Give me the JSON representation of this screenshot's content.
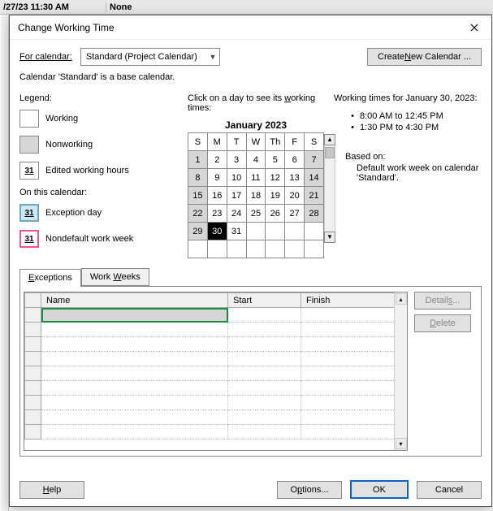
{
  "background": {
    "date": "/27/23 11:30 AM",
    "col2": "None"
  },
  "dialog": {
    "title": "Change Working Time",
    "forCalendarLabel": "For calendar:",
    "forCalendarValue": "Standard (Project Calendar)",
    "createNewBtn_pre": "Create ",
    "createNewBtn_ukey": "N",
    "createNewBtn_post": "ew Calendar ...",
    "baselineText": "Calendar 'Standard' is a base calendar.",
    "legend": {
      "header_pre": "Le",
      "header_ukey": "g",
      "header_post": "end:",
      "working": "Working",
      "nonworking": "Nonworking",
      "editedSwatch": "31",
      "edited": "Edited working hours",
      "onThisCal": "On this calendar:",
      "exSwatch": "31",
      "exception": "Exception day",
      "ndSwatch": "31",
      "nondefault": "Nondefault work week"
    },
    "calendar": {
      "prompt_pre": "Click on a day to see its ",
      "prompt_ukey": "w",
      "prompt_post": "orking times:",
      "monthLabel": "January 2023",
      "dow": [
        "S",
        "M",
        "T",
        "W",
        "Th",
        "F",
        "S"
      ],
      "weeks": [
        [
          {
            "n": "1",
            "w": true
          },
          {
            "n": "2"
          },
          {
            "n": "3"
          },
          {
            "n": "4"
          },
          {
            "n": "5"
          },
          {
            "n": "6"
          },
          {
            "n": "7",
            "w": true
          }
        ],
        [
          {
            "n": "8",
            "w": true
          },
          {
            "n": "9"
          },
          {
            "n": "10"
          },
          {
            "n": "11"
          },
          {
            "n": "12"
          },
          {
            "n": "13"
          },
          {
            "n": "14",
            "w": true
          }
        ],
        [
          {
            "n": "15",
            "w": true
          },
          {
            "n": "16"
          },
          {
            "n": "17"
          },
          {
            "n": "18"
          },
          {
            "n": "19"
          },
          {
            "n": "20"
          },
          {
            "n": "21",
            "w": true
          }
        ],
        [
          {
            "n": "22",
            "w": true
          },
          {
            "n": "23"
          },
          {
            "n": "24"
          },
          {
            "n": "25"
          },
          {
            "n": "26"
          },
          {
            "n": "27"
          },
          {
            "n": "28",
            "w": true
          }
        ],
        [
          {
            "n": "29",
            "w": true
          },
          {
            "n": "30",
            "sel": true
          },
          {
            "n": "31"
          },
          {
            "n": ""
          },
          {
            "n": ""
          },
          {
            "n": ""
          },
          {
            "n": ""
          }
        ],
        [
          {
            "n": ""
          },
          {
            "n": ""
          },
          {
            "n": ""
          },
          {
            "n": ""
          },
          {
            "n": ""
          },
          {
            "n": ""
          },
          {
            "n": ""
          }
        ]
      ]
    },
    "times": {
      "heading": "Working times for January 30, 2023:",
      "items": [
        "8:00 AM to 12:45 PM",
        "1:30 PM to 4:30 PM"
      ],
      "basedOnLabel": "Based on:",
      "basedOnText": "Default work week on calendar 'Standard'."
    },
    "tabs": {
      "exceptions_ukey": "E",
      "exceptions_post": "xceptions",
      "workweeks_pre": "Work ",
      "workweeks_ukey": "W",
      "workweeks_post": "eeks",
      "cols": {
        "name": "Name",
        "start": "Start",
        "finish": "Finish"
      }
    },
    "buttons": {
      "details_pre": "Detail",
      "details_ukey": "s",
      "details_post": "...",
      "delete": "Delete",
      "help_ukey": "H",
      "help_post": "elp",
      "options_pre": "O",
      "options_ukey": "p",
      "options_post": "tions...",
      "ok": "OK",
      "cancel": "Cancel"
    }
  }
}
